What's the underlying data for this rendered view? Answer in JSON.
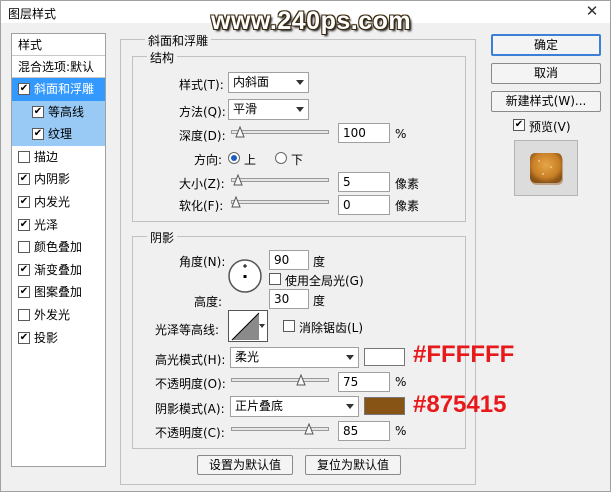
{
  "window": {
    "title": "图层样式",
    "close_glyph": "✕"
  },
  "watermark": "www.240ps.com",
  "left_panel": {
    "header": "样式",
    "subheader": "混合选项:默认",
    "items": [
      {
        "label": "斜面和浮雕",
        "checked": true,
        "selected": true
      },
      {
        "label": "等高线",
        "checked": true,
        "sub": true
      },
      {
        "label": "纹理",
        "checked": true,
        "sub": true
      },
      {
        "label": "描边",
        "checked": false
      },
      {
        "label": "内阴影",
        "checked": true
      },
      {
        "label": "内发光",
        "checked": true
      },
      {
        "label": "光泽",
        "checked": true
      },
      {
        "label": "颜色叠加",
        "checked": false
      },
      {
        "label": "渐变叠加",
        "checked": true
      },
      {
        "label": "图案叠加",
        "checked": true
      },
      {
        "label": "外发光",
        "checked": false
      },
      {
        "label": "投影",
        "checked": true
      }
    ]
  },
  "bevel": {
    "group_title": "斜面和浮雕",
    "structure_title": "结构",
    "style_label": "样式(T):",
    "style_value": "内斜面",
    "method_label": "方法(Q):",
    "method_value": "平滑",
    "depth_label": "深度(D):",
    "depth_value": "100",
    "depth_unit": "%",
    "depth_level": 0.05,
    "direction_label": "方向:",
    "direction_up": "上",
    "direction_down": "下",
    "size_label": "大小(Z):",
    "size_value": "5",
    "size_unit": "像素",
    "size_level": 0.02,
    "soften_label": "软化(F):",
    "soften_value": "0",
    "soften_unit": "像素",
    "soften_level": 0.0
  },
  "shading": {
    "title": "阴影",
    "angle_label": "角度(N):",
    "angle_value": "90",
    "angle_unit": "度",
    "global_light_label": "使用全局光(G)",
    "altitude_label": "高度:",
    "altitude_value": "30",
    "altitude_unit": "度",
    "gloss_label": "光泽等高线:",
    "antialias_label": "消除锯齿(L)",
    "highlight_label": "高光模式(H):",
    "highlight_mode": "柔光",
    "highlight_color": "#FFFFFF",
    "highlight_opacity_label": "不透明度(O):",
    "highlight_opacity": "75",
    "highlight_opacity_unit": "%",
    "highlight_opacity_level": 0.75,
    "shadow_label": "阴影模式(A):",
    "shadow_mode": "正片叠底",
    "shadow_color": "#875415",
    "shadow_opacity_label": "不透明度(C):",
    "shadow_opacity": "85",
    "shadow_opacity_unit": "%",
    "shadow_opacity_level": 0.85
  },
  "buttons": {
    "make_default": "设置为默认值",
    "reset_default": "复位为默认值",
    "ok": "确定",
    "cancel": "取消",
    "new_style": "新建样式(W)...",
    "preview": "预览(V)"
  },
  "annotations": {
    "highlight_hex": "#FFFFFF",
    "shadow_hex": "#875415"
  },
  "colors": {
    "selection": "#3399ff",
    "accent": "#e8191a"
  }
}
